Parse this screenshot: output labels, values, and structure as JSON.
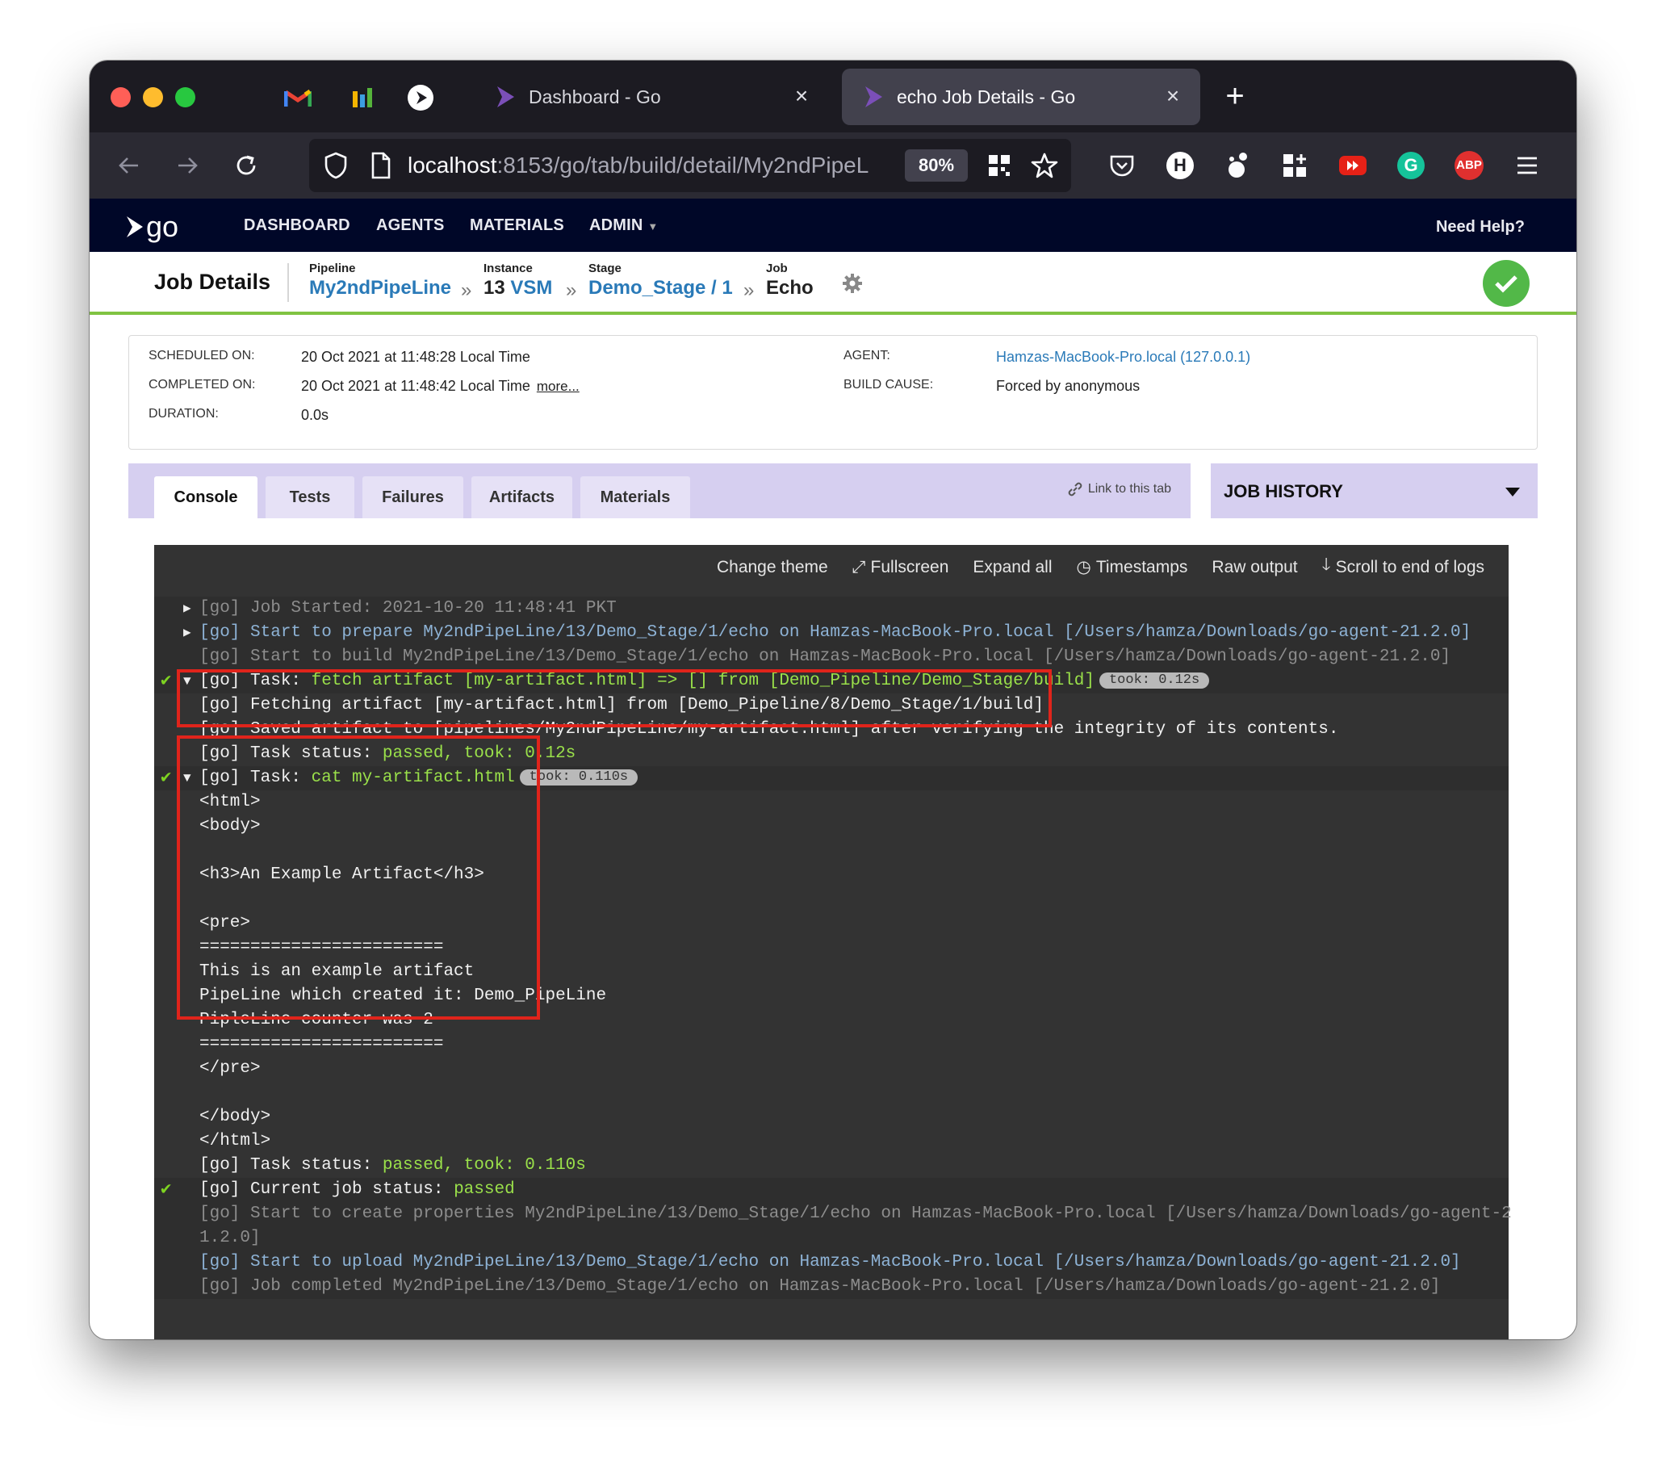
{
  "browser": {
    "tabs": [
      {
        "title": "Dashboard - Go",
        "active": false
      },
      {
        "title": "echo Job Details - Go",
        "active": true
      }
    ],
    "url_host": "localhost",
    "url_rest": ":8153/go/tab/build/detail/My2ndPipeL",
    "zoom": "80%",
    "extensions": [
      "pocket-icon",
      "h-icon",
      "gnome-icon",
      "add-ons-icon",
      "youtube-icon",
      "grammarly-icon",
      "adblock-icon"
    ],
    "abp_label": "ABP",
    "h_label": "H",
    "grammarly_label": "G"
  },
  "gocd_nav": {
    "logo": "go",
    "items": [
      "DASHBOARD",
      "AGENTS",
      "MATERIALS",
      "ADMIN"
    ],
    "help": "Need Help?"
  },
  "job_header": {
    "title": "Job Details",
    "pipeline_label": "Pipeline",
    "pipeline": "My2ndPipeLine",
    "instance_label": "Instance",
    "instance_num": "13",
    "instance_link": "VSM",
    "stage_label": "Stage",
    "stage": "Demo_Stage / 1",
    "job_label": "Job",
    "job": "Echo",
    "chev": "»"
  },
  "summary": {
    "scheduled_label": "SCHEDULED ON:",
    "scheduled": "20 Oct 2021 at 11:48:28 Local Time",
    "completed_label": "COMPLETED ON:",
    "completed": "20 Oct 2021 at 11:48:42 Local Time",
    "more": "more...",
    "duration_label": "DURATION:",
    "duration": "0.0s",
    "agent_label": "AGENT:",
    "agent": "Hamzas-MacBook-Pro.local (127.0.0.1)",
    "cause_label": "BUILD CAUSE:",
    "cause": "Forced by anonymous"
  },
  "tabs": {
    "items": [
      "Console",
      "Tests",
      "Failures",
      "Artifacts",
      "Materials"
    ],
    "active": "Console",
    "link": "Link to this tab",
    "job_history": "JOB HISTORY"
  },
  "console": {
    "toolbar": [
      "Change theme",
      "Fullscreen",
      "Expand all",
      "Timestamps",
      "Raw output",
      "Scroll to end of logs"
    ],
    "lines": {
      "l1": "[go] Job Started: 2021-10-20 11:48:41 PKT",
      "l2": "[go] Start to prepare My2ndPipeLine/13/Demo_Stage/1/echo on Hamzas-MacBook-Pro.local [/Users/hamza/Downloads/go-agent-21.2.0]",
      "l3": "[go] Start to build My2ndPipeLine/13/Demo_Stage/1/echo on Hamzas-MacBook-Pro.local [/Users/hamza/Downloads/go-agent-21.2.0]",
      "l4a": "[go] Task: ",
      "l4b": "fetch artifact [my-artifact.html] => [] from [Demo_Pipeline/Demo_Stage/build]",
      "l4took": "took: 0.12s",
      "l5": "[go] Fetching artifact [my-artifact.html] from [Demo_Pipeline/8/Demo_Stage/1/build]",
      "l6": "[go] Saved artifact to [pipelines/My2ndPipeLine/my-artifact.html] after verifying the integrity of its contents.",
      "l7a": "[go] Task status: ",
      "l7b": "passed, took: 0.12s",
      "l8a": "[go] Task: ",
      "l8b": "cat my-artifact.html",
      "l8took": "took: 0.110s",
      "html_open": "<html>",
      "body_open": "<body>",
      "h3": "<h3>An Example Artifact</h3>",
      "pre_open": "<pre>",
      "rule": "========================",
      "t1": "This is an example artifact",
      "t2": "PipeLine which created it: Demo_PipeLine",
      "t3": "PipleLine counter was 2",
      "pre_close": "</pre>",
      "body_close": "</body>",
      "html_close": "</html>",
      "l9a": "[go] Task status: ",
      "l9b": "passed, took: 0.110s",
      "l10a": "[go] Current job status: ",
      "l10b": "passed",
      "l11": "[go] Start to create properties My2ndPipeLine/13/Demo_Stage/1/echo on Hamzas-MacBook-Pro.local [/Users/hamza/Downloads/go-agent-2",
      "l11b": "1.2.0]",
      "l12": "[go] Start to upload My2ndPipeLine/13/Demo_Stage/1/echo on Hamzas-MacBook-Pro.local [/Users/hamza/Downloads/go-agent-21.2.0]",
      "l13": "[go] Job completed My2ndPipeLine/13/Demo_Stage/1/echo on Hamzas-MacBook-Pro.local [/Users/hamza/Downloads/go-agent-21.2.0]"
    }
  },
  "colors": {
    "go_header": "#000728",
    "link_blue": "#2a7ab8",
    "success_green": "#52b848",
    "console_bg": "#333333",
    "console_green": "#9ae04a",
    "highlight_red": "#e0241b"
  }
}
